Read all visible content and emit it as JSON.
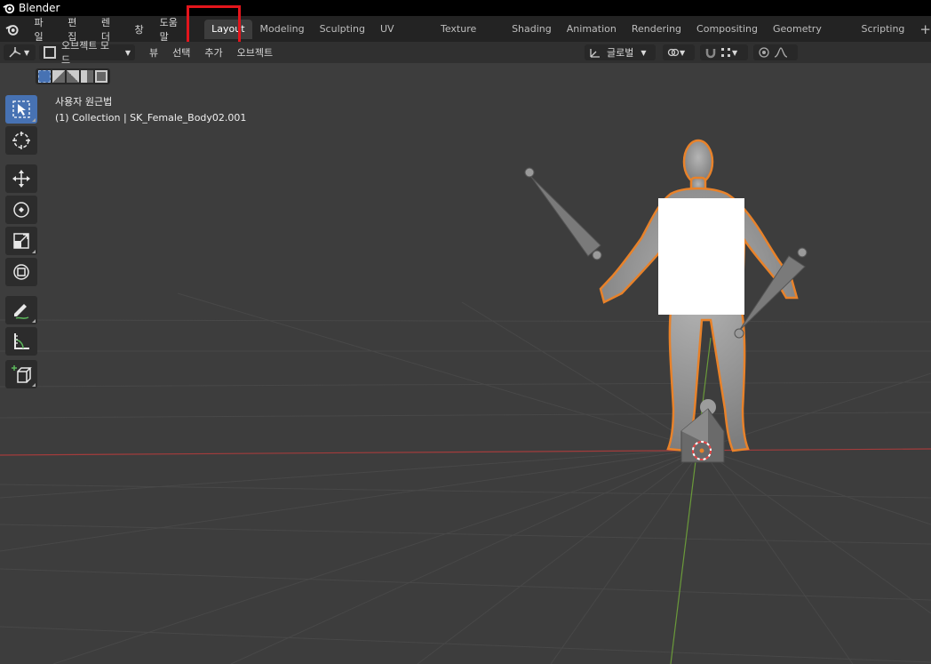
{
  "window": {
    "title": "Blender"
  },
  "menu": [
    "파일",
    "편집",
    "렌더",
    "창",
    "도움말"
  ],
  "workspace_tabs": [
    "Layout",
    "Modeling",
    "Sculpting",
    "UV Editing",
    "Texture Paint",
    "Shading",
    "Animation",
    "Rendering",
    "Compositing",
    "Geometry Nodes",
    "Scripting"
  ],
  "active_tab": "Layout",
  "tab_add": "+",
  "header": {
    "mode": "오브젝트 모드",
    "menus": [
      "뷰",
      "선택",
      "추가",
      "오브젝트"
    ],
    "transform_orientation": "글로벌"
  },
  "viewport": {
    "view_name": "사용자 원근법",
    "collection_info": "(1) Collection | SK_Female_Body02.001"
  },
  "colors": {
    "selection_outline": "#e8822a",
    "x_axis": "#a33c3c",
    "y_axis": "#6a9a3a",
    "active_tool": "#4772b3",
    "annotation_box": "#e3151c"
  },
  "tools": [
    "select-box-icon",
    "cursor-icon",
    "move-icon",
    "rotate-icon",
    "scale-icon",
    "transform-icon",
    "annotate-icon",
    "measure-icon",
    "add-cube-icon"
  ]
}
